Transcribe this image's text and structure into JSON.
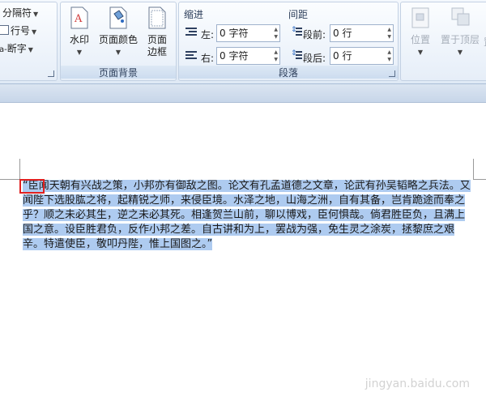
{
  "ribbon": {
    "left_group": {
      "items": [
        "分隔符",
        "行号",
        "断字"
      ]
    },
    "page_background": {
      "title": "页面背景",
      "watermark": "水印",
      "page_color": "页面颜色",
      "page_border_line1": "页面",
      "page_border_line2": "边框"
    },
    "paragraph": {
      "title": "段落",
      "indent_label": "缩进",
      "spacing_label": "间距",
      "left_label": "左:",
      "left_value": "0 字符",
      "right_label": "右:",
      "right_value": "0 字符",
      "before_label": "段前:",
      "before_value": "0 行",
      "after_label": "段后:",
      "after_value": "0 行"
    },
    "arrange": {
      "position": "位置",
      "bring_to_front": "置于顶层",
      "partial": "置"
    }
  },
  "document": {
    "paragraph_text": "“臣闻天朝有兴战之策，小邦亦有御敌之图。论文有孔孟道德之文章，论武有孙吴韬略之兵法。又闻陛下选股肱之将，起精锐之师，来侵臣境。水泽之地，山海之洲，自有其备，岂肯跪途而奉之乎？顺之未必其生，逆之未必其死。相逢贺兰山前，聊以博戏，臣何惧哉。倘君胜臣负，且满上国之意。设臣胜君负，反作小邦之差。自古讲和为上，罢战为强，免生灵之涂炭，拯黎庶之艰辛。特遣使臣，敬叩丹陛，惟上国图之。”"
  },
  "watermark_text": "jingyan.baidu.com",
  "colors": {
    "selection": "#aecbf0",
    "highlight_box": "#e02020",
    "ribbon_top": "#f4f8fd",
    "ribbon_bottom": "#dfe9f5"
  }
}
